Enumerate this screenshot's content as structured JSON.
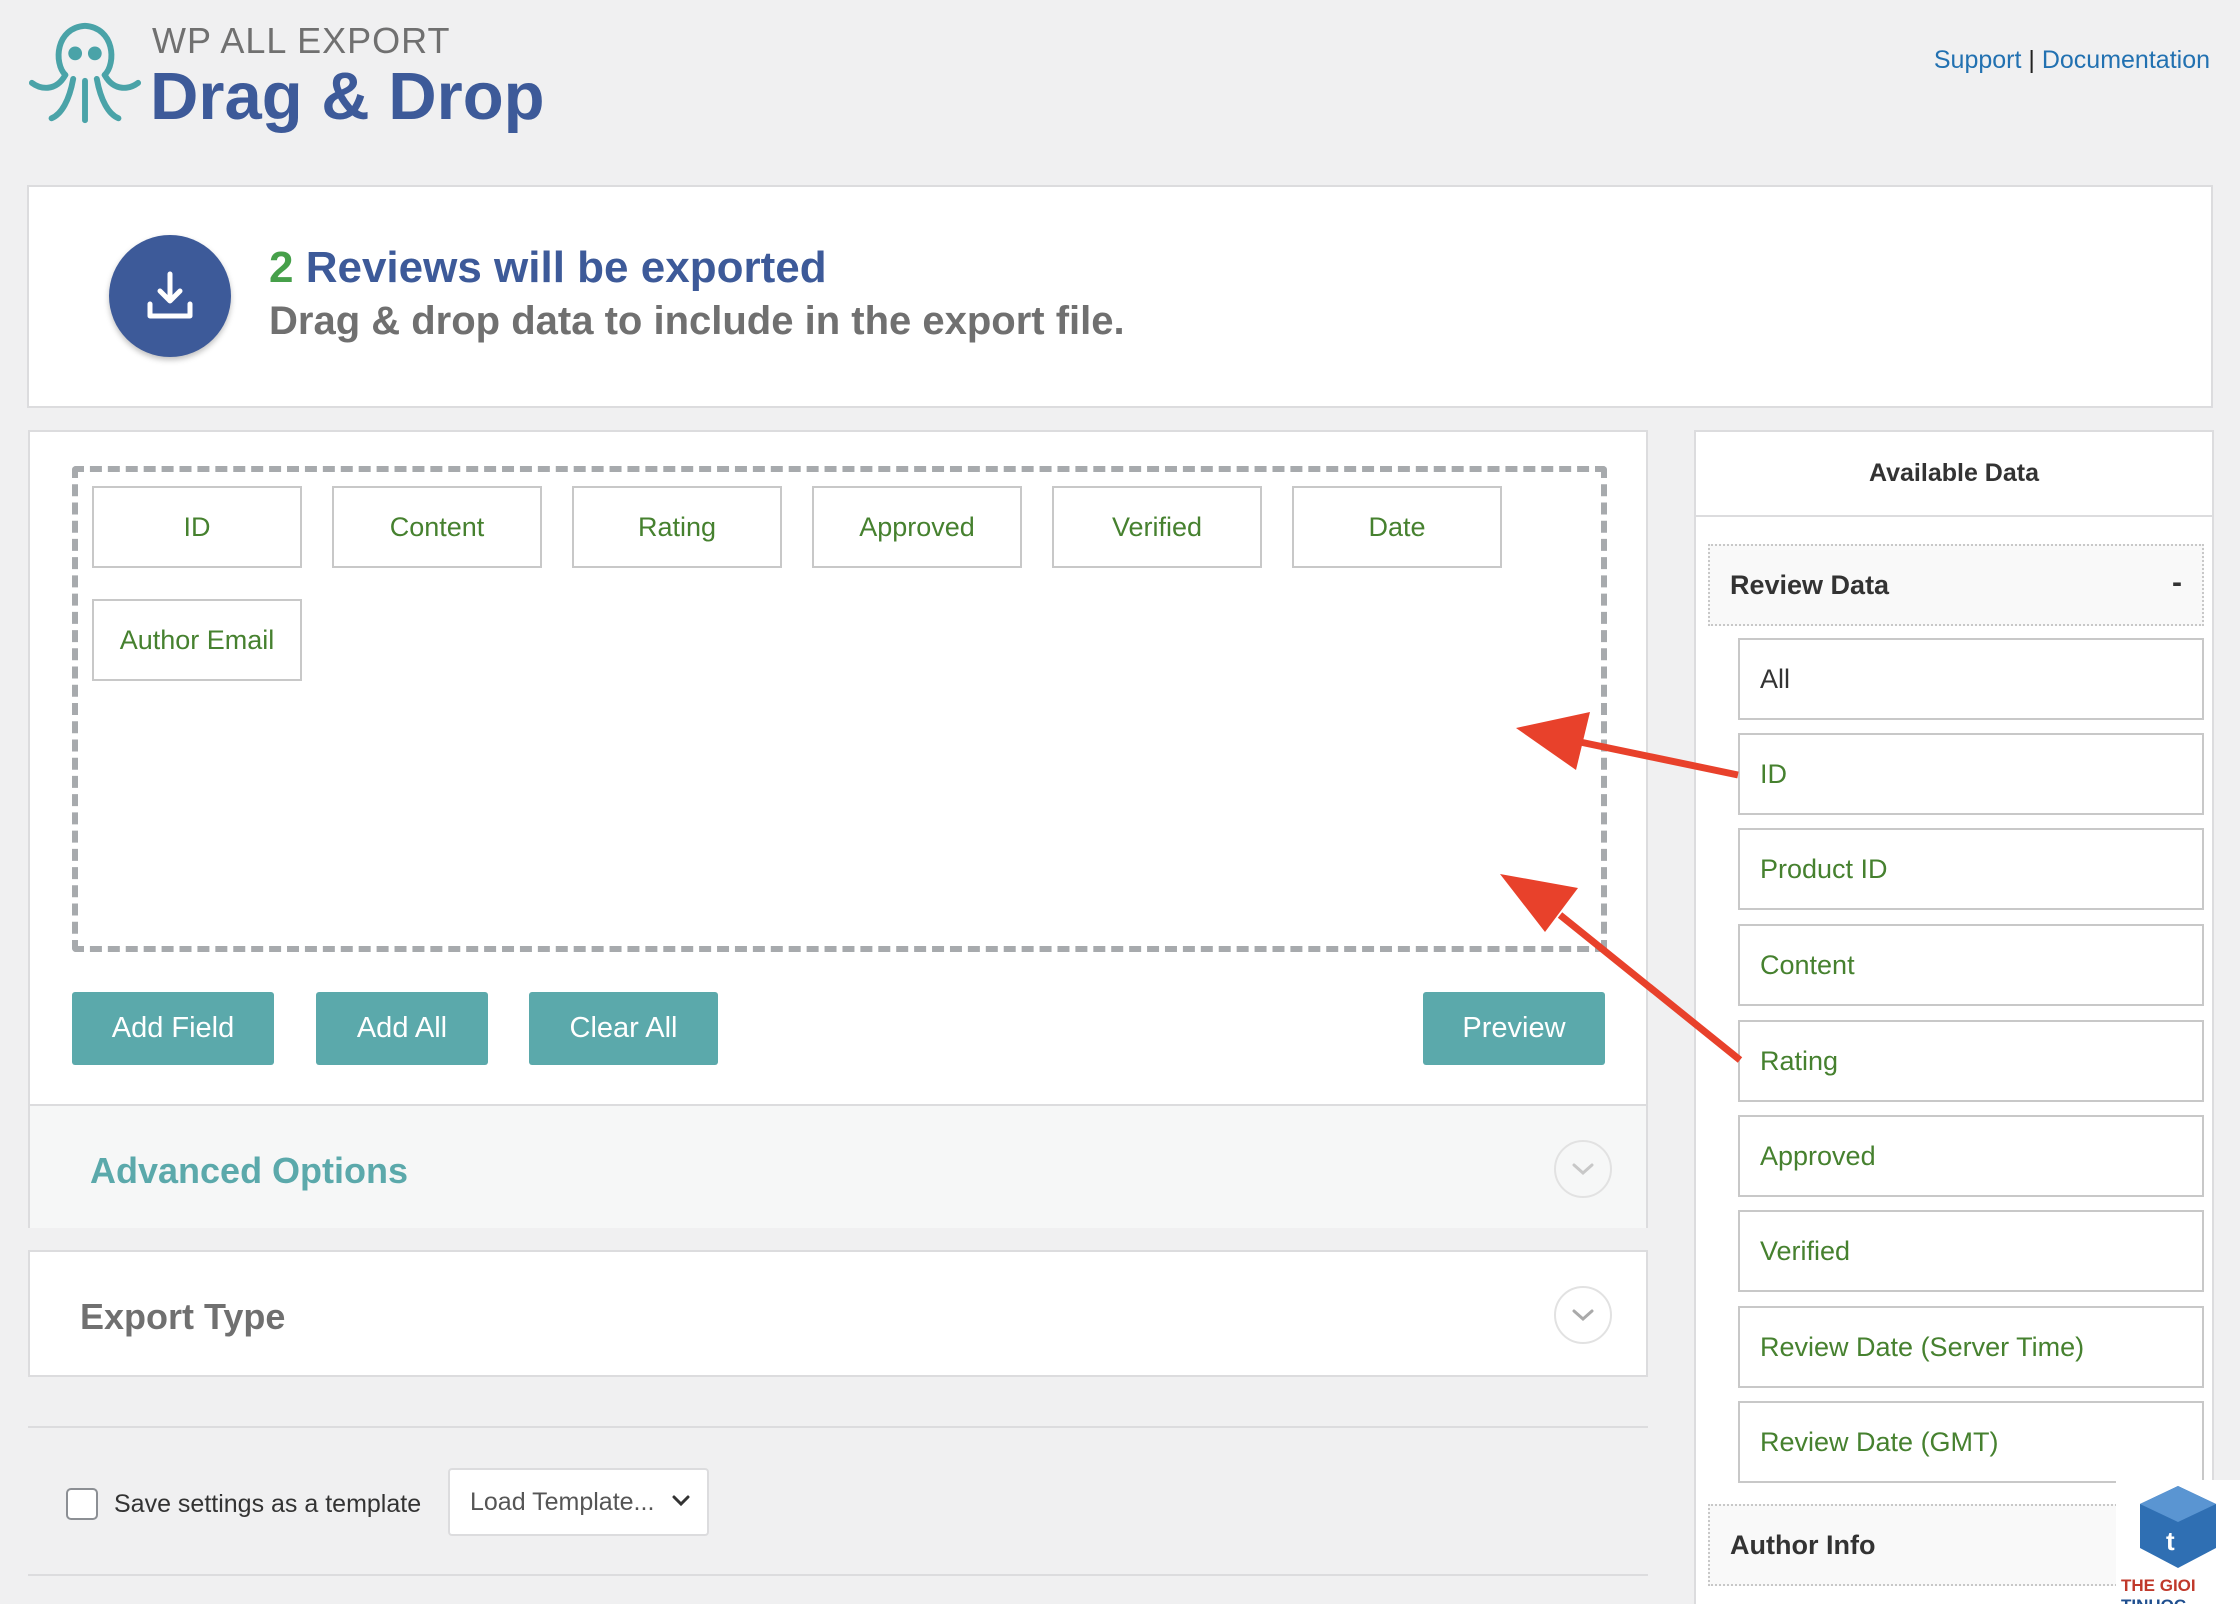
{
  "header": {
    "brand_sub": "WP ALL EXPORT",
    "brand_title": "Drag & Drop",
    "support_link": "Support",
    "separator": "|",
    "docs_link": "Documentation"
  },
  "summary": {
    "count": "2",
    "headline": "Reviews will be exported",
    "subline": "Drag & drop data to include in the export file."
  },
  "export_fields": [
    "ID",
    "Content",
    "Rating",
    "Approved",
    "Verified",
    "Date",
    "Author Email"
  ],
  "buttons": {
    "add_field": "Add Field",
    "add_all": "Add All",
    "clear_all": "Clear All",
    "preview": "Preview"
  },
  "advanced_options": "Advanced Options",
  "export_type": "Export Type",
  "template": {
    "save_label": "Save settings as a template",
    "load_placeholder": "Load Template..."
  },
  "available_data": {
    "title": "Available Data",
    "sections": [
      {
        "label": "Review Data",
        "toggle": "-",
        "items": [
          "All",
          "ID",
          "Product ID",
          "Content",
          "Rating",
          "Approved",
          "Verified",
          "Review Date (Server Time)",
          "Review Date (GMT)"
        ]
      },
      {
        "label": "Author Info"
      }
    ]
  },
  "watermark": {
    "text_part1": "THE GIOI",
    "text_part2": "TINHOC"
  },
  "colors": {
    "brand_blue": "#3d5a99",
    "teal": "#5ba9ab",
    "field_green": "#46812f",
    "count_green": "#46a04a",
    "arrow_red": "#e8412b"
  }
}
